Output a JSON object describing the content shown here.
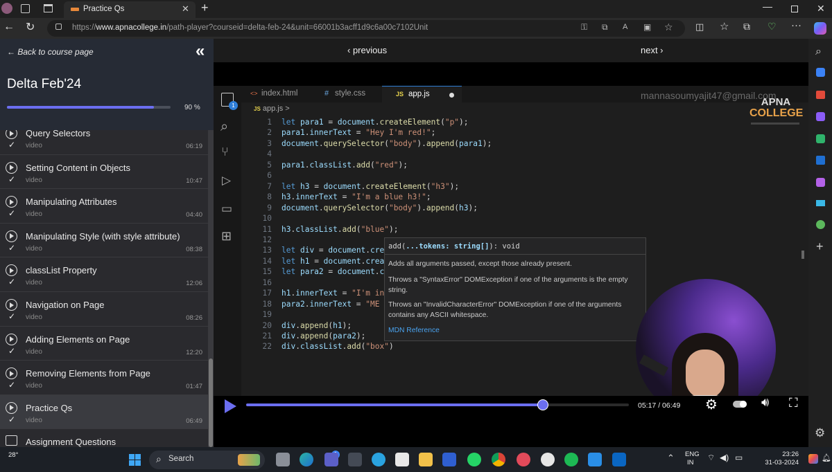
{
  "browser": {
    "tab_title": "Practice Qs",
    "url_prefix": "https://",
    "url_host": "www.apnacollege.in",
    "url_path": "/path-player?courseid=delta-feb-24&unit=66001b3acff1d9c6a00c7102Unit"
  },
  "sidebar": {
    "back_label": "← Back to course page",
    "course_title": "Delta Feb'24",
    "progress_value": 0.9,
    "progress_label": "90 %",
    "lessons": [
      {
        "title": "Query Selectors",
        "type": "video",
        "duration": "06:19",
        "done": true
      },
      {
        "title": "Setting Content in Objects",
        "type": "video",
        "duration": "10:47",
        "done": true
      },
      {
        "title": "Manipulating Attributes",
        "type": "video",
        "duration": "04:40",
        "done": true
      },
      {
        "title": "Manipulating Style (with style attribute)",
        "type": "video",
        "duration": "08:38",
        "done": true
      },
      {
        "title": "classList Property",
        "type": "video",
        "duration": "12:06",
        "done": true
      },
      {
        "title": "Navigation on Page",
        "type": "video",
        "duration": "08:26",
        "done": true
      },
      {
        "title": "Adding Elements on Page",
        "type": "video",
        "duration": "12:20",
        "done": true
      },
      {
        "title": "Removing Elements from Page",
        "type": "video",
        "duration": "01:47",
        "done": true
      },
      {
        "title": "Practice Qs",
        "type": "video",
        "duration": "06:49",
        "done": true,
        "active": true
      },
      {
        "title": "Assignment Questions",
        "type": "",
        "duration": "",
        "done": false
      }
    ]
  },
  "player": {
    "prev_label": "‹ previous",
    "next_label": "next ›",
    "time_label": "05:17 / 06:49",
    "progress_value": 0.775,
    "watermark_email": "mannasoumyajit47@gmail.com",
    "logo_line1": "APNA",
    "logo_line2": "COLLEGE"
  },
  "editor": {
    "tabs": [
      {
        "label": "index.html",
        "glyph": "<>",
        "color": "#e8734a"
      },
      {
        "label": "style.css",
        "glyph": "#",
        "color": "#6aa7e0"
      },
      {
        "label": "app.js",
        "glyph": "JS",
        "color": "#e8d44d",
        "active": true
      }
    ],
    "breadcrumb_file": "app.js",
    "breadcrumb_sep": ">",
    "badge_count": "1",
    "lines": [
      {
        "n": "1",
        "code": "let para1 = document.createElement(\"p\");"
      },
      {
        "n": "2",
        "code": "para1.innerText = \"Hey I'm red!\";"
      },
      {
        "n": "3",
        "code": "document.querySelector(\"body\").append(para1);"
      },
      {
        "n": "4",
        "code": ""
      },
      {
        "n": "5",
        "code": "para1.classList.add(\"red\");"
      },
      {
        "n": "6",
        "code": ""
      },
      {
        "n": "7",
        "code": "let h3 = document.createElement(\"h3\");"
      },
      {
        "n": "8",
        "code": "h3.innerText = \"I'm a blue h3!\";"
      },
      {
        "n": "9",
        "code": "document.querySelector(\"body\").append(h3);"
      },
      {
        "n": "10",
        "code": ""
      },
      {
        "n": "11",
        "code": "h3.classList.add(\"blue\");"
      },
      {
        "n": "12",
        "code": ""
      },
      {
        "n": "13",
        "code": "let div = document.creat"
      },
      {
        "n": "14",
        "code": "let h1 = document.create"
      },
      {
        "n": "15",
        "code": "let para2 = document.cre"
      },
      {
        "n": "16",
        "code": ""
      },
      {
        "n": "17",
        "code": "h1.innerText = \"I'm in a"
      },
      {
        "n": "18",
        "code": "para2.innerText = \"ME TO"
      },
      {
        "n": "19",
        "code": ""
      },
      {
        "n": "20",
        "code": "div.append(h1);"
      },
      {
        "n": "21",
        "code": "div.append(para2);"
      },
      {
        "n": "22",
        "code": "div.classList.add(\"box\")"
      }
    ],
    "tooltip": {
      "signature_pre": "add(",
      "signature_param": "...tokens: string[]",
      "signature_post": "): void",
      "desc": "Adds all arguments passed, except those already present.",
      "throws1": "Throws a \"SyntaxError\" DOMException if one of the arguments is the empty string.",
      "throws2": "Throws an \"InvalidCharacterError\" DOMException if one of the arguments contains any ASCII whitespace.",
      "link": "MDN Reference"
    }
  },
  "taskbar": {
    "weather": "28°",
    "search_placeholder": "Search",
    "notif_badge": "1",
    "lang1": "ENG",
    "lang2": "IN",
    "time": "23:26",
    "date": "31-03-2024"
  },
  "colors": {
    "accent": "#6b6ef0",
    "sidebar_bg": "#2a2a2e",
    "editor_bg": "#1e1e1e"
  }
}
